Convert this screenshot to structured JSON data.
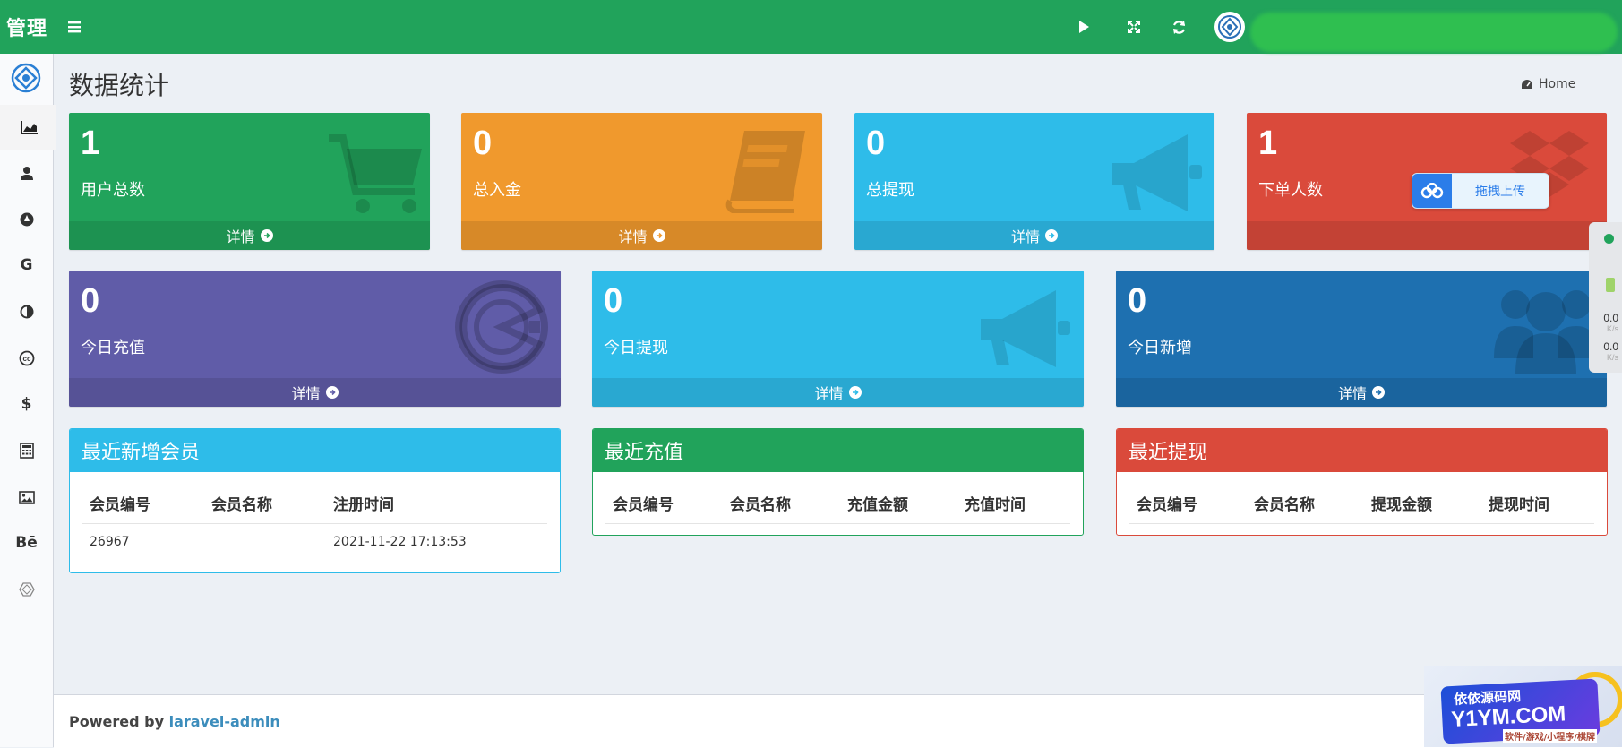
{
  "header": {
    "brand": "管理",
    "colors": {
      "header": "#21a35b"
    },
    "icons": [
      "menu-icon",
      "play-icon",
      "expand-icon",
      "refresh-icon",
      "user-avatar-icon"
    ]
  },
  "sidebar": {
    "items": [
      {
        "icon": "area-chart-icon"
      },
      {
        "icon": "user-icon"
      },
      {
        "icon": "compass-icon"
      },
      {
        "icon": "google-icon",
        "text": "G"
      },
      {
        "icon": "contrast-icon"
      },
      {
        "icon": "cc-icon"
      },
      {
        "icon": "dollar-icon",
        "text": "$"
      },
      {
        "icon": "calculator-icon"
      },
      {
        "icon": "image-icon"
      },
      {
        "icon": "behance-icon",
        "text": "Bē"
      },
      {
        "icon": "hexagon-icon"
      }
    ]
  },
  "page": {
    "title": "数据统计",
    "breadcrumb": "Home"
  },
  "stats_row1": [
    {
      "value": "1",
      "label": "用户总数",
      "footer": "详情",
      "color": "#21a35b",
      "icon": "cart-icon"
    },
    {
      "value": "0",
      "label": "总入金",
      "footer": "详情",
      "color": "#f0992d",
      "icon": "book-icon"
    },
    {
      "value": "0",
      "label": "总提现",
      "footer": "详情",
      "color": "#2ebce9",
      "icon": "bullhorn-icon"
    },
    {
      "value": "1",
      "label": "下单人数",
      "footer": "",
      "color": "#da4a3b",
      "icon": "dropbox-icon"
    }
  ],
  "stats_row2": [
    {
      "value": "0",
      "label": "今日充值",
      "footer": "详情",
      "color": "#605ca8",
      "icon": "pacman-icon"
    },
    {
      "value": "0",
      "label": "今日提现",
      "footer": "详情",
      "color": "#2ebce9",
      "icon": "bullhorn-icon"
    },
    {
      "value": "0",
      "label": "今日新增",
      "footer": "详情",
      "color": "#1e70b0",
      "icon": "users-icon"
    }
  ],
  "upload": {
    "label": "拖拽上传"
  },
  "tables": {
    "members": {
      "title": "最近新增会员",
      "color": "#2ebce9",
      "columns": [
        "会员编号",
        "会员名称",
        "注册时间"
      ],
      "rows": [
        [
          "26967",
          "",
          "2021-11-22 17:13:53"
        ]
      ]
    },
    "recharge": {
      "title": "最近充值",
      "color": "#21a35b",
      "columns": [
        "会员编号",
        "会员名称",
        "充值金额",
        "充值时间"
      ],
      "rows": []
    },
    "withdraw": {
      "title": "最近提现",
      "color": "#da4a3b",
      "columns": [
        "会员编号",
        "会员名称",
        "提现金额",
        "提现时间"
      ],
      "rows": []
    }
  },
  "footer": {
    "powered": "Powered by",
    "link": "laravel-admin"
  },
  "net_monitor": {
    "up": "0.0",
    "down": "0.0",
    "unit": "K/s"
  },
  "watermark": {
    "title": "依依源码网",
    "site": "Y1YM.COM",
    "sub": "软件/游戏/小程序/棋牌"
  }
}
